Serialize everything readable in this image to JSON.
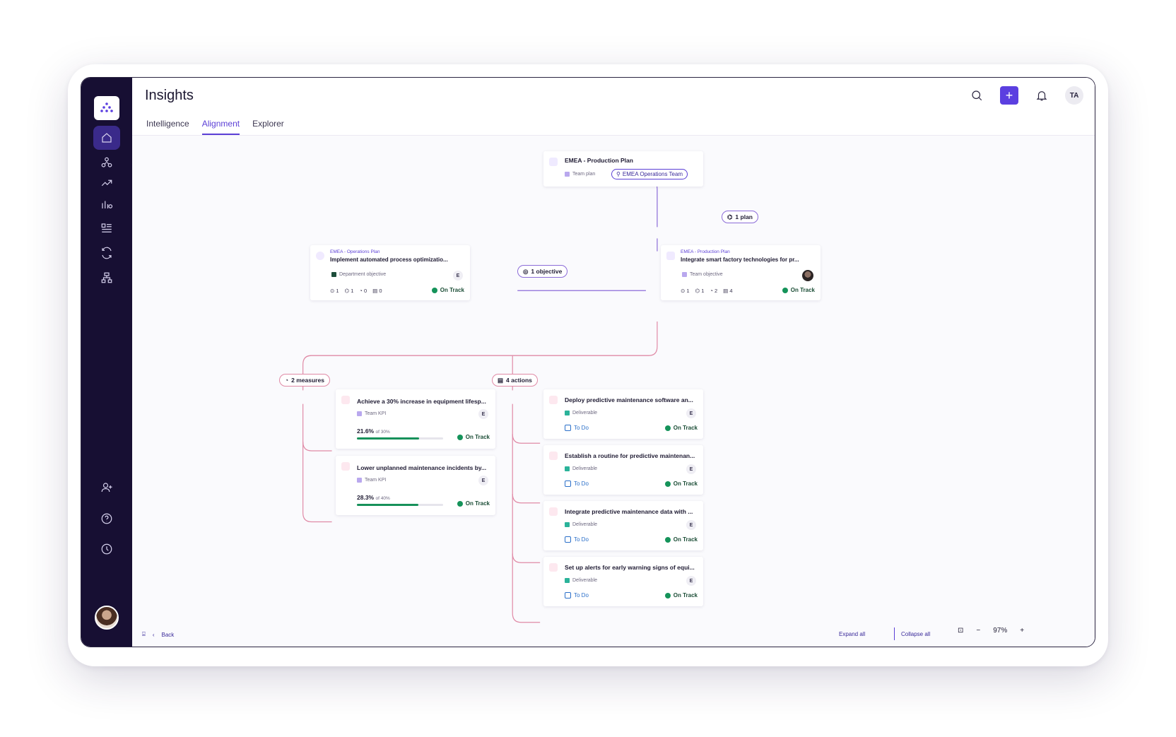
{
  "page": {
    "title": "Insights",
    "user_initials": "TA",
    "plus_label": "+"
  },
  "tabs": [
    {
      "label": "Intelligence"
    },
    {
      "label": "Alignment"
    },
    {
      "label": "Explorer"
    }
  ],
  "nav_icons": [
    "home-icon",
    "hierarchy-icon",
    "trend-icon",
    "bar-chart-icon",
    "list-icon",
    "refresh-icon",
    "tree-icon",
    "add-user-icon",
    "help-icon",
    "history-icon"
  ],
  "plan_card": {
    "title": "EMEA - Production Plan",
    "tag": "Team plan",
    "team": "EMEA Operations Team"
  },
  "plan_pill": "1 plan",
  "objective_pill": "1 objective",
  "dept_objective": {
    "kicker": "EMEA - Operations Plan",
    "title": "Implement automated process optimizatio...",
    "tag": "Department objective",
    "badge": "E",
    "counts": [
      "1",
      "1",
      "0",
      "0"
    ],
    "status": "On Track"
  },
  "team_objective": {
    "kicker": "EMEA - Production Plan",
    "title": "Integrate smart factory technologies for pr...",
    "tag": "Team objective",
    "counts": [
      "1",
      "1",
      "2",
      "4"
    ],
    "status": "On Track"
  },
  "measures_pill": "2 measures",
  "actions_pill": "4 actions",
  "measures": [
    {
      "title": "Achieve a 30% increase in equipment lifesp...",
      "tag": "Team KPI",
      "badge": "E",
      "value": "21.6%",
      "target": "of 30%",
      "progress": 0.72,
      "status": "On Track"
    },
    {
      "title": "Lower unplanned maintenance incidents by...",
      "tag": "Team KPI",
      "badge": "E",
      "value": "28.3%",
      "target": "of 40%",
      "progress": 0.71,
      "status": "On Track"
    }
  ],
  "actions": [
    {
      "title": "Deploy predictive maintenance software an...",
      "tag": "Deliverable",
      "badge": "E",
      "todo": "To Do",
      "status": "On Track"
    },
    {
      "title": "Establish a routine for predictive maintenan...",
      "tag": "Deliverable",
      "badge": "E",
      "todo": "To Do",
      "status": "On Track"
    },
    {
      "title": "Integrate predictive maintenance data with ...",
      "tag": "Deliverable",
      "badge": "E",
      "todo": "To Do",
      "status": "On Track"
    },
    {
      "title": "Set up alerts for early warning signs of equi...",
      "tag": "Deliverable",
      "badge": "E",
      "todo": "To Do",
      "status": "On Track"
    }
  ],
  "bottom": {
    "back": "Back",
    "expand": "Expand all",
    "collapse": "Collapse all",
    "zoom": "97%",
    "minus": "−",
    "plus": "+"
  },
  "colors": {
    "sidebar": "#170f33",
    "accent": "#5b3fe0",
    "on_track": "#15935a",
    "objective_link": "#8b6bd8",
    "action_link": "#e08aa6"
  }
}
